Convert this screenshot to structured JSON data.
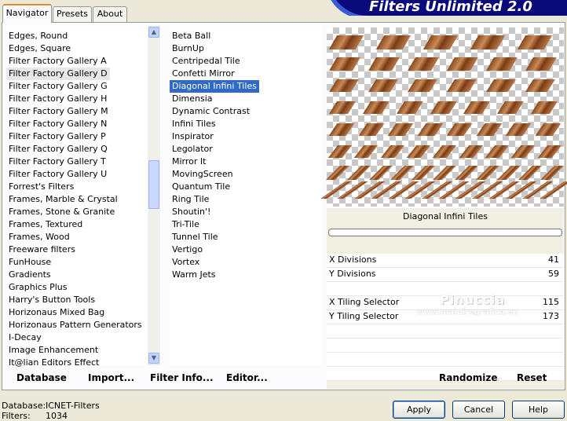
{
  "tabs": [
    "Navigator",
    "Presets",
    "About"
  ],
  "banner_title": "Filters Unlimited 2.0",
  "categories": [
    "Edges, Round",
    "Edges, Square",
    "Filter Factory Gallery A",
    "Filter Factory Gallery D",
    "Filter Factory Gallery G",
    "Filter Factory Gallery H",
    "Filter Factory Gallery M",
    "Filter Factory Gallery N",
    "Filter Factory Gallery P",
    "Filter Factory Gallery Q",
    "Filter Factory Gallery T",
    "Filter Factory Gallery U",
    "Forrest's Filters",
    "Frames, Marble & Crystal",
    "Frames, Stone & Granite",
    "Frames, Textured",
    "Frames, Wood",
    "Freeware filters",
    "FunHouse",
    "Gradients",
    "Graphics Plus",
    "Harry's Button Tools",
    "Horizonaus Mixed Bag",
    "Horizonaus Pattern Generators",
    "I-Decay",
    "Image Enhancement",
    "It@lian Editors Effect"
  ],
  "selected_category": "Filter Factory Gallery D",
  "filters": [
    "Beta Ball",
    "BurnUp",
    "Centripedal Tile",
    "Confetti Mirror",
    "Diagonal Infini Tiles",
    "Dimensia",
    "Dynamic Contrast",
    "Infini Tiles",
    "Inspirator",
    "Legolator",
    "Mirror It",
    "MovingScreen",
    "Quantum Tile",
    "Ring Tile",
    "Shoutin'!",
    "Tri-Tile",
    "Tunnel Tile",
    "Vertigo",
    "Vortex",
    "Warm Jets"
  ],
  "selected_filter": "Diagonal Infini Tiles",
  "preview_label": "Diagonal Infini Tiles",
  "params": [
    {
      "label": "X Divisions",
      "value": "41"
    },
    {
      "label": "Y Divisions",
      "value": "59"
    },
    {
      "label": "X Tiling Selector",
      "value": "115"
    },
    {
      "label": "Y Tiling Selector",
      "value": "173"
    }
  ],
  "bottom_buttons": [
    "Database",
    "Import...",
    "Filter Info...",
    "Editor..."
  ],
  "randomize_label": "Randomize",
  "reset_label": "Reset",
  "watermark": {
    "line1": "Pinuccia",
    "line2": "www.maidiregrafica.eu"
  },
  "status": {
    "database_label": "Database:",
    "database_value": "ICNET-Filters",
    "filters_label": "Filters:",
    "filters_value": "1034"
  },
  "dialog_buttons": {
    "apply": "Apply",
    "cancel": "Cancel",
    "help": "Help"
  },
  "colors": {
    "selection": "#316ac5",
    "banner": "#0a0a7a",
    "tab_accent": "#e68b2c",
    "tile": "#a86a3a"
  }
}
